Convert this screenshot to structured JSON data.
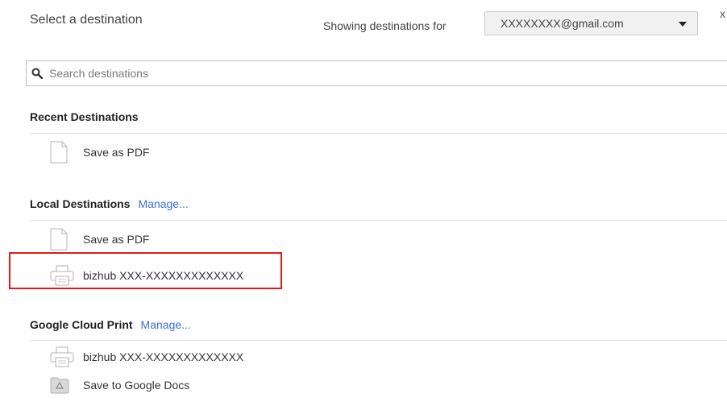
{
  "dialog": {
    "title": "Select a destination",
    "close_symbol": "x"
  },
  "account": {
    "label": "Showing destinations for",
    "selected": "XXXXXXXX@gmail.com"
  },
  "search": {
    "placeholder": "Search destinations",
    "value": "",
    "icon": "search-icon"
  },
  "sections": {
    "recent": {
      "title": "Recent Destinations",
      "items": [
        {
          "label": "Save as PDF",
          "icon": "pdf-document-icon"
        }
      ]
    },
    "local": {
      "title": "Local Destinations",
      "manage_label": "Manage...",
      "items": [
        {
          "label": "Save as PDF",
          "icon": "pdf-document-icon"
        },
        {
          "label": "bizhub XXX-XXXXXXXXXXXXX",
          "icon": "printer-icon",
          "highlighted": true
        }
      ]
    },
    "cloud": {
      "title": "Google Cloud Print",
      "manage_label": "Manage...",
      "items": [
        {
          "label": "bizhub XXX-XXXXXXXXXXXXX",
          "icon": "printer-icon"
        },
        {
          "label": "Save to Google Docs",
          "icon": "google-drive-icon"
        }
      ]
    }
  },
  "colors": {
    "link": "#3b6fd1",
    "highlight": "#e01b1b"
  }
}
